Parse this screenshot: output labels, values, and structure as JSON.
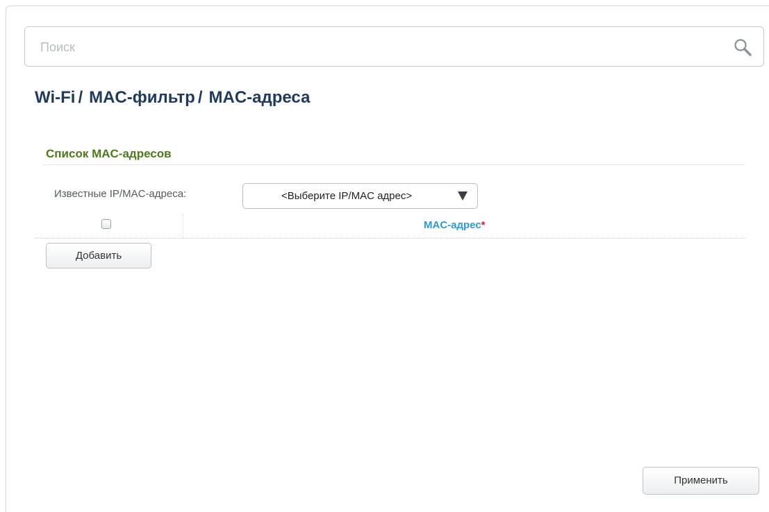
{
  "search": {
    "placeholder": "Поиск",
    "value": ""
  },
  "breadcrumb": {
    "items": [
      "Wi-Fi",
      "MAC-фильтр",
      "MAC-адреса"
    ],
    "separator": "/"
  },
  "section": {
    "title": "Список MAC-адресов"
  },
  "known_addresses": {
    "label": "Известные IP/MAC-адреса:",
    "selected": "<Выберите IP/MAC адрес>"
  },
  "table": {
    "select_all_checked": false,
    "columns": [
      {
        "label": "MAC-адрес",
        "required_mark": "*"
      }
    ],
    "rows": []
  },
  "actions": {
    "add_label": "Добавить",
    "apply_label": "Применить"
  },
  "colors": {
    "breadcrumb": "#1e3a5c",
    "section_title": "#4a7a1c",
    "column_header": "#2a9ad8",
    "required_mark": "#d32121"
  }
}
